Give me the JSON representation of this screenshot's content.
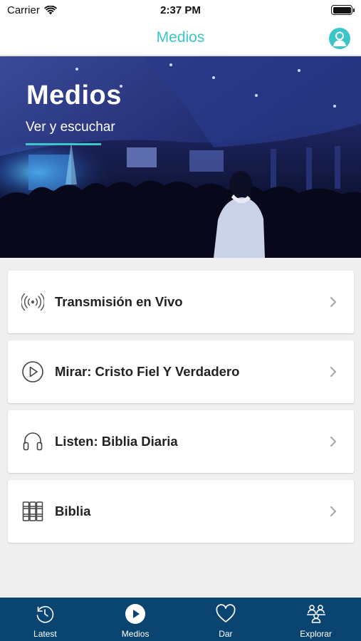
{
  "status_bar": {
    "carrier": "Carrier",
    "time": "2:37 PM"
  },
  "nav": {
    "title": "Medios"
  },
  "hero": {
    "title": "Medios",
    "subtitle": "Ver y escuchar"
  },
  "menu": {
    "items": [
      {
        "label": "Transmisión en Vivo",
        "icon": "live-broadcast-icon"
      },
      {
        "label": "Mirar: Cristo Fiel Y Verdadero",
        "icon": "play-circle-icon"
      },
      {
        "label": "Listen: Biblia Diaria",
        "icon": "headphones-icon"
      },
      {
        "label": "Biblia",
        "icon": "bible-books-icon"
      }
    ]
  },
  "tabs": [
    {
      "label": "Latest",
      "icon": "history-icon"
    },
    {
      "label": "Medios",
      "icon": "play-circle-icon",
      "selected": true
    },
    {
      "label": "Dar",
      "icon": "heart-icon"
    },
    {
      "label": "Explorar",
      "icon": "people-icon"
    }
  ],
  "colors": {
    "accent": "#3cc6c9",
    "tab_bar": "#0a4572"
  }
}
